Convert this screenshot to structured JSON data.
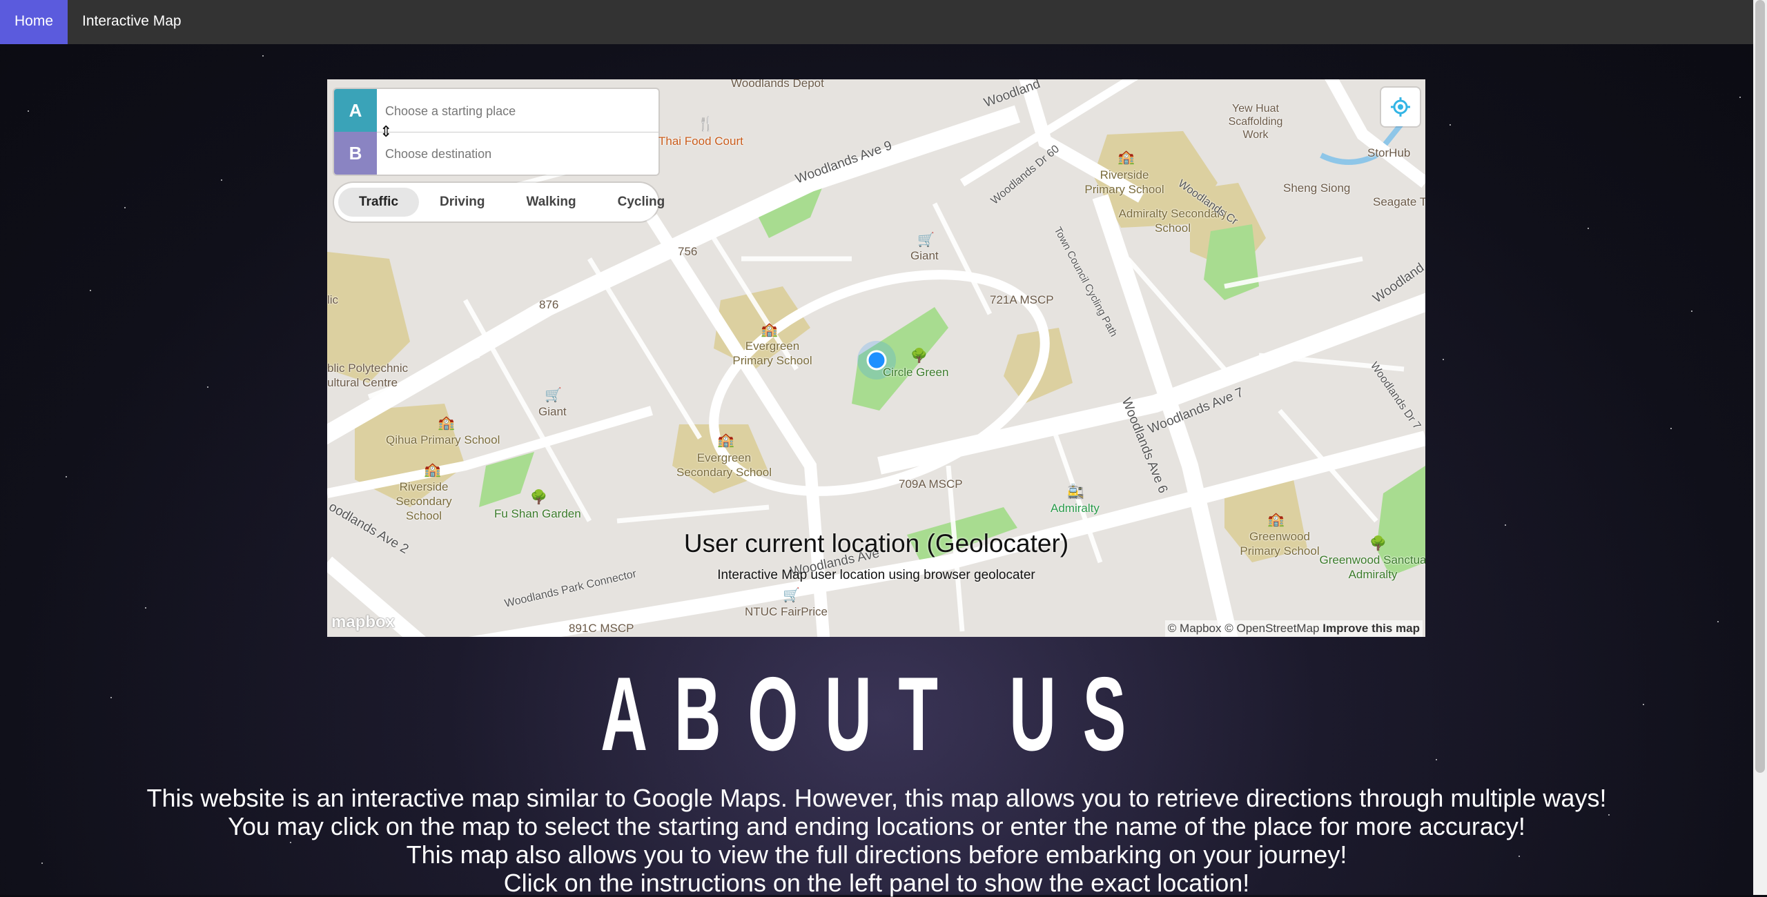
{
  "nav": {
    "items": [
      {
        "label": "Home",
        "active": true
      },
      {
        "label": "Interactive Map",
        "active": false
      }
    ]
  },
  "map": {
    "directions": {
      "origin": {
        "letter": "A",
        "placeholder": "Choose a starting place",
        "color": "#3aa3b8"
      },
      "destination": {
        "letter": "B",
        "placeholder": "Choose destination",
        "color": "#8a84c2"
      },
      "profiles": [
        "Traffic",
        "Driving",
        "Walking",
        "Cycling"
      ],
      "selected_profile": "Traffic"
    },
    "overlay_title": "User current location (Geolocater)",
    "overlay_subtitle": "Interactive Map user location using browser geolocater",
    "attribution": "© Mapbox © OpenStreetMap",
    "improve_link": "Improve this map",
    "logo_text": "mapbox",
    "labels": {
      "woodlands_depot": "Woodlands Depot",
      "thai_food_court": "Thai Food Court",
      "woodlands_ave9": "Woodlands Ave 9",
      "woodlands_top": "Woodland",
      "woodlands_dr60": "Woodlands Dr 60",
      "yew_huat": "Yew Huat Scaffolding Work",
      "storhub": "StorHub",
      "sheng_siong": "Sheng Siong",
      "seagate": "Seagate Te",
      "riverside_ps": "Riverside Primary School",
      "admiralty_ss": "Admiralty Secondary School",
      "woodlands_cr": "Woodlands Cr",
      "town_council": "Town Council Cycling Path",
      "giant_top": "Giant",
      "b756": "756",
      "b876": "876",
      "b721a": "721A MSCP",
      "evergreen_ps": "Evergreen Primary School",
      "circle_green": "Circle Green",
      "polytechnic": "blic Polytechnic ultural Centre",
      "lic": "lic",
      "giant_left": "Giant",
      "qihua_ps": "Qihua Primary School",
      "riverside_ss": "Riverside Secondary School",
      "evergreen_ss": "Evergreen Secondary School",
      "b709a": "709A MSCP",
      "woodlands_ave6": "Woodlands Ave 6",
      "woodlands_ave7": "Woodlands Ave 7",
      "woodlands_dr7": "Woodlands Dr 7",
      "woodland_right": "Woodland",
      "admiralty": "Admiralty",
      "fu_shan": "Fu Shan Garden",
      "woodlands_ave2": "oodlands Ave 2",
      "greenwood_ps": "Greenwood Primary School",
      "greenwood_sanct": "Greenwood Sanctua Admiralty",
      "woodlands_ave_lower": "Woodlands Ave",
      "park_connector": "Woodlands Park Connector",
      "ntuc": "NTUC FairPrice",
      "b891c": "891C MSCP"
    }
  },
  "about": {
    "heading": "ABOUT US",
    "lines": [
      "This website is an interactive map similar to Google Maps. However, this map allows you to retrieve directions through multiple ways!",
      "You may click on the map to select the starting and ending locations or enter the name of the place for more accuracy!",
      "This map also allows you to view the full directions before embarking on your journey!",
      "Click on the instructions on the left panel to show the exact location!"
    ]
  },
  "colors": {
    "nav_bg": "#333333",
    "nav_active": "#5b5bdd",
    "location_dot": "#1e90ff",
    "school_area": "#dcd0a0",
    "park": "#a8dc90"
  }
}
